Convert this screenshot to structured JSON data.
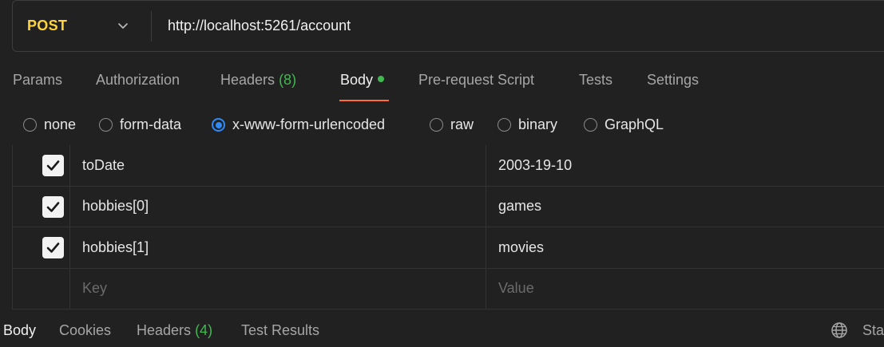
{
  "request": {
    "method": "POST",
    "url": "http://localhost:5261/account"
  },
  "request_tabs": [
    {
      "label": "Params"
    },
    {
      "label": "Authorization"
    },
    {
      "label": "Headers",
      "count": "(8)"
    },
    {
      "label": "Body",
      "active": true,
      "has_dot": true
    },
    {
      "label": "Pre-request Script"
    },
    {
      "label": "Tests"
    },
    {
      "label": "Settings"
    }
  ],
  "body_types": [
    {
      "label": "none",
      "selected": false
    },
    {
      "label": "form-data",
      "selected": false
    },
    {
      "label": "x-www-form-urlencoded",
      "selected": true
    },
    {
      "label": "raw",
      "selected": false
    },
    {
      "label": "binary",
      "selected": false
    },
    {
      "label": "GraphQL",
      "selected": false
    }
  ],
  "params": [
    {
      "checked": true,
      "key": "toDate",
      "value": "2003-19-10"
    },
    {
      "checked": true,
      "key": "hobbies[0]",
      "value": "games"
    },
    {
      "checked": true,
      "key": "hobbies[1]",
      "value": "movies"
    }
  ],
  "empty_row": {
    "key_placeholder": "Key",
    "value_placeholder": "Value"
  },
  "response_tabs": [
    {
      "label": "Body",
      "active": true
    },
    {
      "label": "Cookies"
    },
    {
      "label": "Headers",
      "count": "(4)"
    },
    {
      "label": "Test Results"
    }
  ],
  "response_status_truncated": "Sta",
  "colors": {
    "method": "#ffd43b",
    "accent_underline": "#ff6c37",
    "count_green": "#3fb950",
    "radio_selected": "#2f8af5",
    "background": "#212121"
  },
  "icons": {
    "method_dropdown": "chevron-down-icon",
    "checkbox_mark": "checkmark-icon",
    "network": "globe-icon"
  }
}
